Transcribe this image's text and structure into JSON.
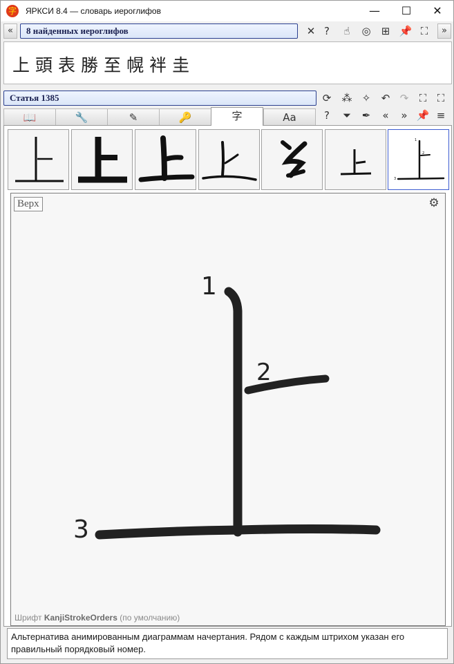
{
  "window": {
    "title": "ЯРКСИ 8.4 — словарь иероглифов",
    "app_icon_glyph": "字",
    "controls": {
      "minimize": "—",
      "maximize": "☐",
      "close": "✕"
    }
  },
  "search": {
    "nav_left": "«",
    "nav_right": "»",
    "result_label": "8 найденных иероглифов",
    "toolbar_icons": [
      "clear-icon",
      "help-icon",
      "hand-icon",
      "spiral-icon",
      "tree-icon",
      "pin-icon",
      "shrink-icon"
    ],
    "toolbar_glyphs": [
      "✕",
      "?",
      "☝",
      "◎",
      "⊞",
      "📌",
      "⛶"
    ]
  },
  "results": {
    "kanji": [
      "上",
      "頭",
      "表",
      "勝",
      "至",
      "幌",
      "袢",
      "圭"
    ]
  },
  "article": {
    "label": "Статья 1385",
    "toolbar_icons": [
      "refresh-icon",
      "graph-icon",
      "broom-icon",
      "back-icon",
      "forward-icon",
      "expand-icon",
      "fullscreen-icon"
    ],
    "toolbar_glyphs": [
      "⟳",
      "⁂",
      "✧",
      "↶",
      "↷",
      "⛶",
      "⛶"
    ]
  },
  "tabs": [
    {
      "name": "tab-book",
      "icon": "book-icon",
      "glyph": "📖"
    },
    {
      "name": "tab-tools",
      "icon": "wrench-icon",
      "glyph": "🔧"
    },
    {
      "name": "tab-brush",
      "icon": "brush-icon",
      "glyph": "✎"
    },
    {
      "name": "tab-keys",
      "icon": "key-icon",
      "glyph": "🔑"
    },
    {
      "name": "tab-kanji",
      "icon": "kanji-icon",
      "glyph": "字",
      "active": true
    },
    {
      "name": "tab-font",
      "icon": "font-icon",
      "glyph": "Aa"
    }
  ],
  "tab_toolbar": {
    "icons": [
      "help-icon",
      "filter-icon",
      "brush-icon",
      "prev-icon",
      "next-icon",
      "pin-icon",
      "menu-icon"
    ],
    "glyphs": [
      "?",
      "⏷",
      "✒",
      "«",
      "»",
      "📌",
      "≡"
    ]
  },
  "variants": {
    "selected_index": 6,
    "count": 7
  },
  "diagram": {
    "position_button": "Верх",
    "settings_icon": "gear-icon",
    "settings_glyph": "⚙",
    "stroke_numbers": [
      "1",
      "2",
      "3"
    ],
    "font_prefix": "Шрифт",
    "font_name": "KanjiStrokeOrders",
    "font_suffix": "(по умолчанию)"
  },
  "description": "Альтернатива анимированным диаграммам начертания. Рядом с каждым штрихом указан его правильный порядковый номер."
}
